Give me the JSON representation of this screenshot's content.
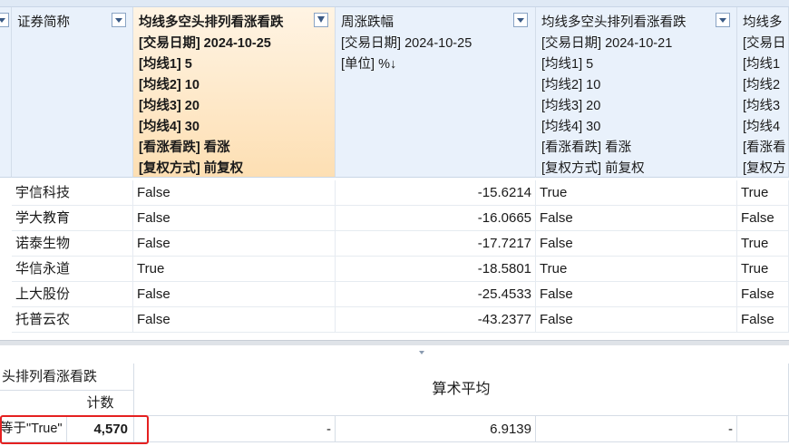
{
  "columns": [
    {
      "label": "证券简称",
      "params": []
    },
    {
      "label": "均线多空头排列看涨看跌",
      "params": [
        "[交易日期] 2024-10-25",
        "[均线1] 5",
        "[均线2] 10",
        "[均线3] 20",
        "[均线4] 30",
        "[看涨看跌] 看涨",
        "[复权方式] 前复权"
      ]
    },
    {
      "label": "周涨跌幅",
      "params": [
        "[交易日期] 2024-10-25",
        "[单位] %↓"
      ]
    },
    {
      "label": "均线多空头排列看涨看跌",
      "params": [
        "[交易日期] 2024-10-21",
        "[均线1] 5",
        "[均线2] 10",
        "[均线3] 20",
        "[均线4] 30",
        "[看涨看跌] 看涨",
        "[复权方式] 前复权"
      ]
    },
    {
      "label": "均线多",
      "params": [
        "[交易日",
        "[均线1",
        "[均线2",
        "[均线3",
        "[均线4",
        "[看涨看",
        "[复权方"
      ]
    }
  ],
  "rows": [
    {
      "name": "宇信科技",
      "a": "False",
      "chg": "-15.6214",
      "b": "True",
      "c": "True"
    },
    {
      "name": "学大教育",
      "a": "False",
      "chg": "-16.0665",
      "b": "False",
      "c": "False"
    },
    {
      "name": "诺泰生物",
      "a": "False",
      "chg": "-17.7217",
      "b": "False",
      "c": "True"
    },
    {
      "name": "华信永道",
      "a": "True",
      "chg": "-18.5801",
      "b": "True",
      "c": "True"
    },
    {
      "name": "上大股份",
      "a": "False",
      "chg": "-25.4533",
      "b": "False",
      "c": "False"
    },
    {
      "name": "托普云农",
      "a": "False",
      "chg": "-43.2377",
      "b": "False",
      "c": "False"
    }
  ],
  "stats": {
    "group_header": "头排列看涨看跌",
    "count_header": "计数",
    "mean_header": "算术平均",
    "filter_label": "等于\"True\"",
    "count_value": "4,570",
    "dash1": "-",
    "mean_value": "6.9139",
    "dash2": "-"
  }
}
